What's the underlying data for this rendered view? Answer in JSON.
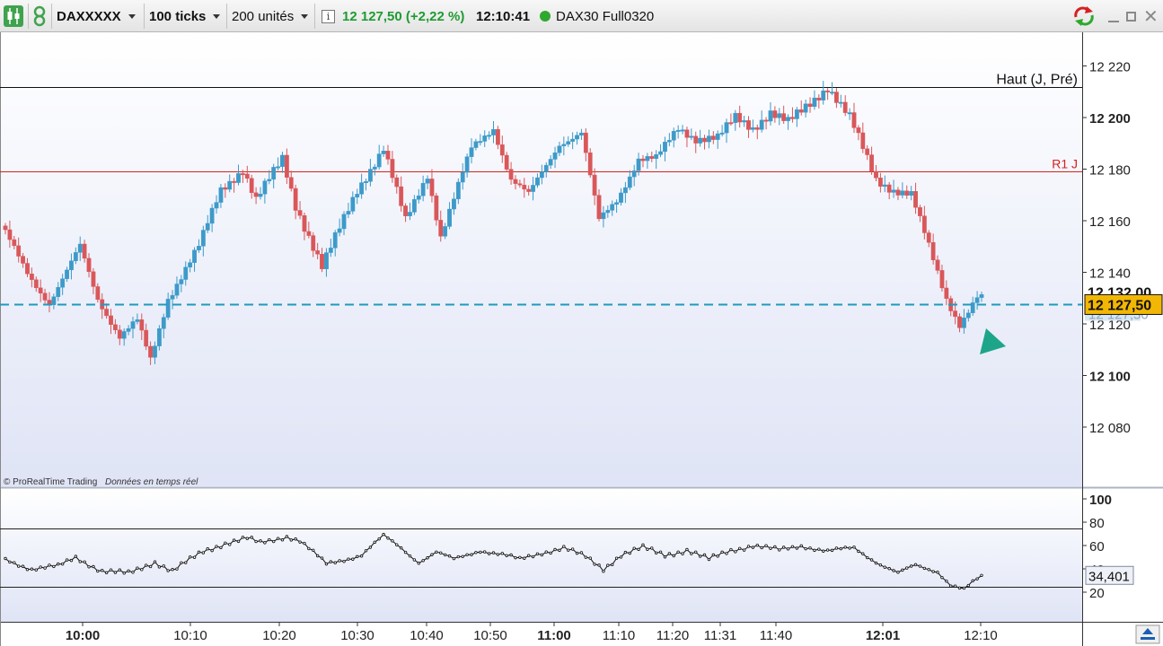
{
  "toolbar": {
    "instrument": "DAXXXXX",
    "ticks": "100 ticks",
    "units": "200 unités",
    "info_icon": "info-icon",
    "price": "12 127,50",
    "change": "(+2,22 %)",
    "time": "12:10:41",
    "contract": "DAX30 Full0320",
    "status_color": "#2ea82e"
  },
  "watermark": {
    "copyright": "© ProRealTime Trading",
    "realtime": "Données en temps réel"
  },
  "colors": {
    "up": "#3d9ac9",
    "down": "#d9575a",
    "current_line": "#1f9bbf",
    "r1": "#d62020",
    "price_tag": "#f2b705"
  },
  "chart_data": [
    {
      "type": "candlestick",
      "ylim": [
        12060,
        12230
      ],
      "y_ticks": [
        "12 220",
        "12 200",
        "12 180",
        "12 160",
        "12 140",
        "12 120",
        "12 100",
        "12 080"
      ],
      "x_ticks": [
        "10:00",
        "10:10",
        "10:20",
        "10:30",
        "10:40",
        "10:50",
        "11:00",
        "11:10",
        "11:20",
        "11:31",
        "11:40",
        "12:01",
        "12:10"
      ],
      "x_ticks_bold": [
        "10:00",
        "11:00",
        "12:01"
      ],
      "levels": [
        {
          "label": "Haut (J, Pré)",
          "value": 12212
        },
        {
          "label": "R1 J",
          "value": 12179
        }
      ],
      "current_price": 12127.5,
      "price_tags": [
        {
          "label": "12 132,00",
          "value": 12132
        },
        {
          "label": "12 127,50",
          "value": 12127.5
        },
        {
          "label": "12 127,50",
          "value": 12124
        }
      ],
      "waypoints": [
        [
          0,
          12158
        ],
        [
          6,
          12140
        ],
        [
          11,
          12128
        ],
        [
          15,
          12140
        ],
        [
          18,
          12150
        ],
        [
          22,
          12130
        ],
        [
          27,
          12115
        ],
        [
          31,
          12121
        ],
        [
          34,
          12106
        ],
        [
          38,
          12130
        ],
        [
          45,
          12150
        ],
        [
          50,
          12172
        ],
        [
          55,
          12180
        ],
        [
          58,
          12168
        ],
        [
          64,
          12184
        ],
        [
          67,
          12166
        ],
        [
          73,
          12142
        ],
        [
          81,
          12172
        ],
        [
          87,
          12188
        ],
        [
          92,
          12160
        ],
        [
          97,
          12178
        ],
        [
          100,
          12154
        ],
        [
          107,
          12188
        ],
        [
          112,
          12196
        ],
        [
          116,
          12176
        ],
        [
          120,
          12170
        ],
        [
          127,
          12190
        ],
        [
          132,
          12194
        ],
        [
          136,
          12160
        ],
        [
          140,
          12168
        ],
        [
          145,
          12184
        ],
        [
          149,
          12184
        ],
        [
          154,
          12196
        ],
        [
          158,
          12192
        ],
        [
          163,
          12192
        ],
        [
          167,
          12200
        ],
        [
          171,
          12196
        ],
        [
          175,
          12202
        ],
        [
          179,
          12198
        ],
        [
          183,
          12204
        ],
        [
          188,
          12212
        ],
        [
          193,
          12200
        ],
        [
          199,
          12176
        ],
        [
          203,
          12172
        ],
        [
          207,
          12170
        ],
        [
          215,
          12130
        ],
        [
          218,
          12120
        ],
        [
          222,
          12130
        ]
      ],
      "n_candles": 223
    },
    {
      "type": "line",
      "series": [
        {
          "name": "",
          "value_label": "34,401",
          "last_value": 34.401
        }
      ],
      "ylim": [
        0,
        100
      ],
      "y_ticks": [
        "100",
        "80",
        "60",
        "40",
        "20"
      ],
      "bands": [
        75,
        25
      ],
      "waypoints": [
        [
          0,
          48
        ],
        [
          6,
          40
        ],
        [
          12,
          42
        ],
        [
          16,
          50
        ],
        [
          22,
          38
        ],
        [
          28,
          36
        ],
        [
          34,
          46
        ],
        [
          38,
          38
        ],
        [
          45,
          55
        ],
        [
          50,
          62
        ],
        [
          55,
          66
        ],
        [
          58,
          62
        ],
        [
          64,
          68
        ],
        [
          67,
          64
        ],
        [
          73,
          44
        ],
        [
          81,
          52
        ],
        [
          86,
          68
        ],
        [
          90,
          58
        ],
        [
          94,
          46
        ],
        [
          98,
          54
        ],
        [
          102,
          48
        ],
        [
          108,
          56
        ],
        [
          113,
          52
        ],
        [
          117,
          48
        ],
        [
          122,
          54
        ],
        [
          127,
          58
        ],
        [
          132,
          50
        ],
        [
          136,
          40
        ],
        [
          140,
          52
        ],
        [
          145,
          58
        ],
        [
          150,
          52
        ],
        [
          155,
          56
        ],
        [
          160,
          48
        ],
        [
          165,
          56
        ],
        [
          170,
          60
        ],
        [
          176,
          56
        ],
        [
          181,
          60
        ],
        [
          187,
          55
        ],
        [
          193,
          58
        ],
        [
          199,
          44
        ],
        [
          203,
          36
        ],
        [
          207,
          43
        ],
        [
          212,
          38
        ],
        [
          215,
          26
        ],
        [
          218,
          22
        ],
        [
          222,
          34
        ]
      ]
    }
  ]
}
